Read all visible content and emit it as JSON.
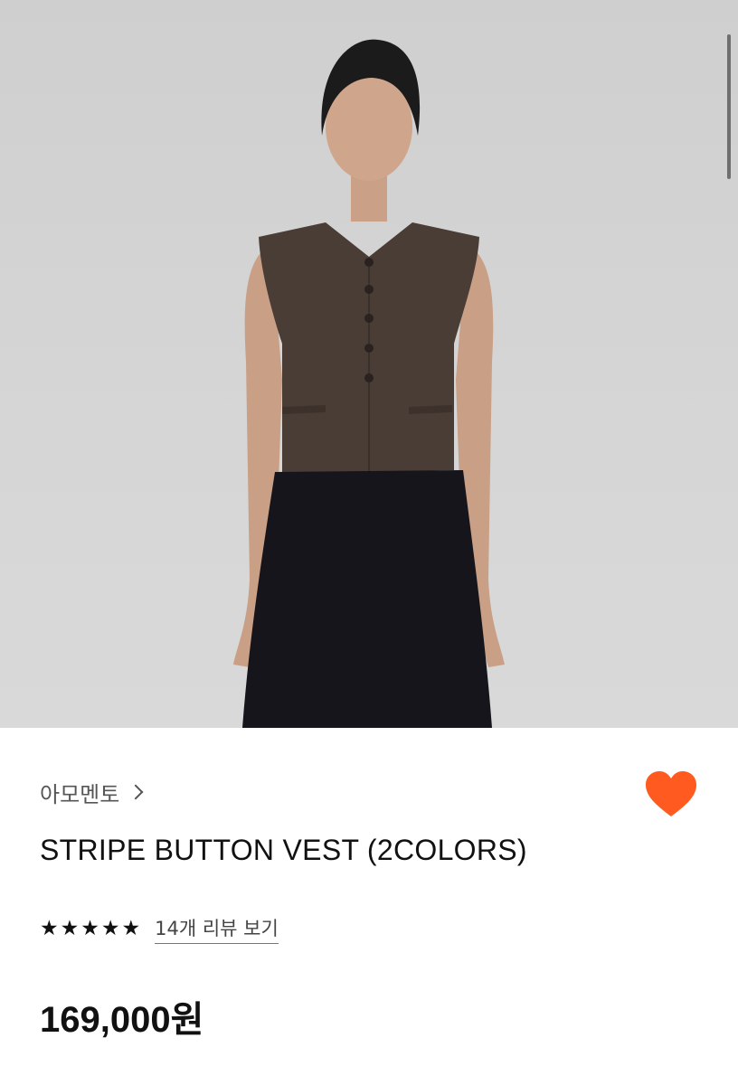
{
  "product": {
    "brand": "아모멘토",
    "title": "STRIPE BUTTON VEST (2COLORS)",
    "review_link": "14개 리뷰 보기",
    "rating_stars": 5,
    "price": "169,000원"
  },
  "icons": {
    "wishlist": "heart-icon",
    "brand_chevron": "chevron-right-icon",
    "star": "star-icon"
  },
  "colors": {
    "heart": "#FF5A1F",
    "text": "#111111",
    "muted": "#555555"
  }
}
